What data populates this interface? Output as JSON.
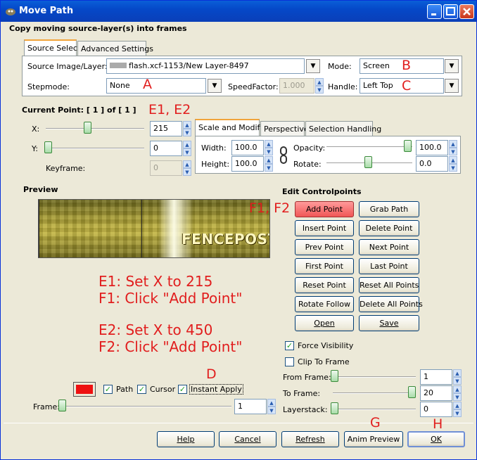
{
  "window": {
    "title": "Move Path",
    "header": "Copy moving source-layer(s) into frames"
  },
  "tabs_top": [
    {
      "label": "Source Select",
      "active": true
    },
    {
      "label": "Advanced Settings",
      "active": false
    }
  ],
  "source": {
    "image_label": "Source Image/Layer:",
    "image_value": "flash.xcf-1153/New Layer-8497",
    "mode_label": "Mode:",
    "mode_value": "Screen",
    "stepmode_label": "Stepmode:",
    "stepmode_value": "None",
    "speed_label": "SpeedFactor:",
    "speed_value": "1.000",
    "handle_label": "Handle:",
    "handle_value": "Left  Top"
  },
  "current_point": {
    "label": "Current Point: [   1 ] of [   1 ]"
  },
  "xy": {
    "x_label": "X:",
    "x_value": "215",
    "y_label": "Y:",
    "y_value": "0",
    "keyframe_label": "Keyframe:",
    "keyframe_value": "0"
  },
  "tabs_mid": [
    {
      "label": "Scale and Modify",
      "active": true
    },
    {
      "label": "Perspective",
      "active": false
    },
    {
      "label": "Selection Handling",
      "active": false
    }
  ],
  "scale": {
    "width_label": "Width:",
    "width_value": "100.0",
    "height_label": "Height:",
    "height_value": "100.0",
    "opacity_label": "Opacity:",
    "opacity_value": "100.0",
    "rotate_label": "Rotate:",
    "rotate_value": "0.0"
  },
  "preview": {
    "label": "Preview",
    "logo_text": "FENCEPOST"
  },
  "controlpoints": {
    "label": "Edit Controlpoints",
    "buttons": [
      "Add Point",
      "Grab Path",
      "Insert Point",
      "Delete Point",
      "Prev Point",
      "Next Point",
      "First Point",
      "Last Point",
      "Reset Point",
      "Reset All Points",
      "Rotate Follow",
      "Delete All Points",
      "Open",
      "Save"
    ]
  },
  "checks": {
    "force_visibility": "Force Visibility",
    "clip_to_frame": "Clip To Frame",
    "path": "Path",
    "cursor": "Cursor",
    "instant_apply": "Instant Apply"
  },
  "frames": {
    "from_label": "From Frame:",
    "from_value": "1",
    "to_label": "To Frame:",
    "to_value": "20",
    "layerstack_label": "Layerstack:",
    "layerstack_value": "0",
    "frame_label": "Frame:",
    "frame_value": "1"
  },
  "bottom_buttons": {
    "help": "Help",
    "cancel": "Cancel",
    "refresh": "Refresh",
    "anim_preview": "Anim Preview",
    "ok": "OK"
  },
  "annotations": {
    "A": "A",
    "B": "B",
    "C": "C",
    "D": "D",
    "G": "G",
    "H": "H",
    "E12": "E1, E2",
    "F12": "F1, F2",
    "steps": [
      "E1: Set X to 215",
      "F1: Click \"Add Point\"",
      "E2: Set X to 450",
      "F2: Click \"Add Point\""
    ]
  },
  "colors": {
    "annotation": "#e11e1e",
    "path_color": "#ee1111",
    "add_point_highlight": "#f05656"
  }
}
